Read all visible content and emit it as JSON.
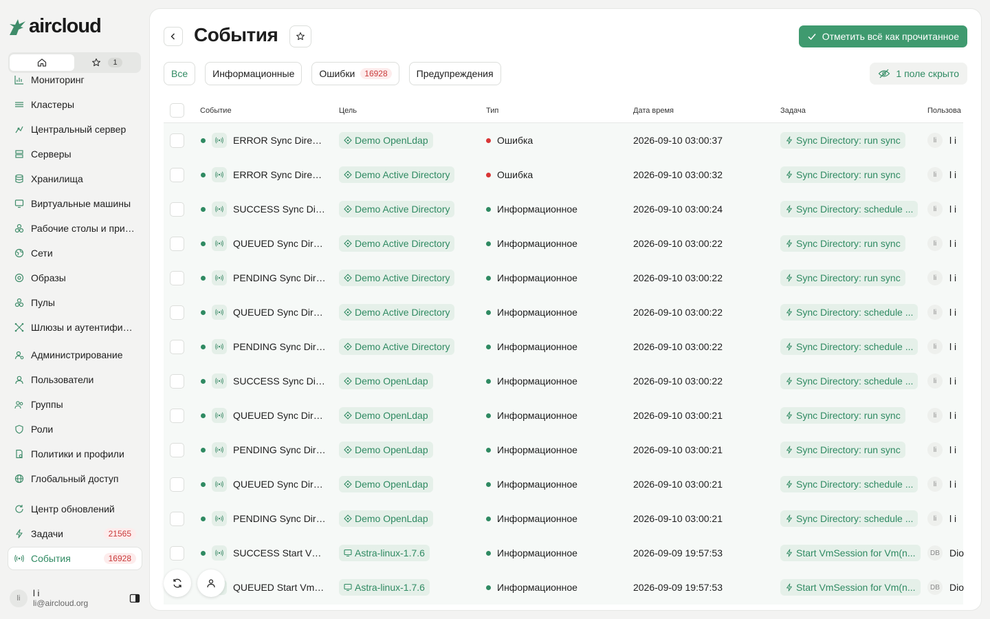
{
  "app": {
    "logo_text": "aircloud"
  },
  "quick": {
    "fav_count": "1"
  },
  "nav": [
    {
      "label": "Мониторинг",
      "icon": "chart-icon"
    },
    {
      "label": "Кластеры",
      "icon": "layers-icon"
    },
    {
      "label": "Центральный сервер",
      "icon": "sliders-icon"
    },
    {
      "label": "Серверы",
      "icon": "server-icon"
    },
    {
      "label": "Хранилища",
      "icon": "database-icon"
    },
    {
      "label": "Виртуальные машины",
      "icon": "monitor-icon"
    },
    {
      "label": "Рабочие столы и прил...",
      "icon": "desktop-apps-icon"
    },
    {
      "label": "Сети",
      "icon": "globe-network-icon"
    },
    {
      "label": "Образы",
      "icon": "disc-icon"
    },
    {
      "label": "Пулы",
      "icon": "pool-icon"
    },
    {
      "label": "Шлюзы и аутентифика...",
      "icon": "gateway-icon"
    },
    {
      "label": "Администрирование",
      "icon": "admin-icon"
    },
    {
      "label": "Пользователи",
      "icon": "user-icon"
    },
    {
      "label": "Группы",
      "icon": "group-icon"
    },
    {
      "label": "Роли",
      "icon": "shield-icon"
    },
    {
      "label": "Политики и профили",
      "icon": "policy-icon"
    },
    {
      "label": "Глобальный доступ",
      "icon": "globe-icon"
    },
    {
      "label": "Центр обновлений",
      "icon": "refresh-icon"
    },
    {
      "label": "Задачи",
      "icon": "bolt-icon",
      "count": "21565"
    },
    {
      "label": "События",
      "icon": "broadcast-icon",
      "count": "16928",
      "active": true
    }
  ],
  "user": {
    "initials": "li",
    "name": "l i",
    "email": "li@aircloud.org"
  },
  "page": {
    "title": "События",
    "mark_all_read": "Отметить всё как прочитанное",
    "hidden_fields": "1 поле скрыто"
  },
  "tabs": [
    {
      "label": "Все",
      "active": true
    },
    {
      "label": "Информационные"
    },
    {
      "label": "Ошибки",
      "count": "16928"
    },
    {
      "label": "Предупреждения"
    }
  ],
  "columns": [
    "Событие",
    "Цель",
    "Тип",
    "Дата время",
    "Задача",
    "Пользова"
  ],
  "rows": [
    {
      "event": "ERROR Sync Directory: run sync",
      "target": "Demo OpenLdap",
      "target_icon": "directory-icon",
      "type": "Ошибка",
      "type_color": "#d93636",
      "datetime": "2026-09-10 03:00:37",
      "task": "Sync Directory: run sync",
      "user_initials": "li",
      "user_name": "l i"
    },
    {
      "event": "ERROR Sync Directory: run sync",
      "target": "Demo Active Directory",
      "target_icon": "directory-icon",
      "type": "Ошибка",
      "type_color": "#d93636",
      "datetime": "2026-09-10 03:00:32",
      "task": "Sync Directory: run sync",
      "user_initials": "li",
      "user_name": "l i"
    },
    {
      "event": "SUCCESS Sync Directory: schedule",
      "target": "Demo Active Directory",
      "target_icon": "directory-icon",
      "type": "Информационное",
      "type_color": "#2f8a62",
      "datetime": "2026-09-10 03:00:24",
      "task": "Sync Directory: schedule ...",
      "user_initials": "li",
      "user_name": "l i"
    },
    {
      "event": "QUEUED Sync Directory: run sync",
      "target": "Demo Active Directory",
      "target_icon": "directory-icon",
      "type": "Информационное",
      "type_color": "#2f8a62",
      "datetime": "2026-09-10 03:00:22",
      "task": "Sync Directory: run sync",
      "user_initials": "li",
      "user_name": "l i"
    },
    {
      "event": "PENDING Sync Directory: run sync",
      "target": "Demo Active Directory",
      "target_icon": "directory-icon",
      "type": "Информационное",
      "type_color": "#2f8a62",
      "datetime": "2026-09-10 03:00:22",
      "task": "Sync Directory: run sync",
      "user_initials": "li",
      "user_name": "l i"
    },
    {
      "event": "QUEUED Sync Directory: schedule",
      "target": "Demo Active Directory",
      "target_icon": "directory-icon",
      "type": "Информационное",
      "type_color": "#2f8a62",
      "datetime": "2026-09-10 03:00:22",
      "task": "Sync Directory: schedule ...",
      "user_initials": "li",
      "user_name": "l i"
    },
    {
      "event": "PENDING Sync Directory: schedule",
      "target": "Demo Active Directory",
      "target_icon": "directory-icon",
      "type": "Информационное",
      "type_color": "#2f8a62",
      "datetime": "2026-09-10 03:00:22",
      "task": "Sync Directory: schedule ...",
      "user_initials": "li",
      "user_name": "l i"
    },
    {
      "event": "SUCCESS Sync Directory: schedule",
      "target": "Demo OpenLdap",
      "target_icon": "directory-icon",
      "type": "Информационное",
      "type_color": "#2f8a62",
      "datetime": "2026-09-10 03:00:22",
      "task": "Sync Directory: schedule ...",
      "user_initials": "li",
      "user_name": "l i"
    },
    {
      "event": "QUEUED Sync Directory: run sync",
      "target": "Demo OpenLdap",
      "target_icon": "directory-icon",
      "type": "Информационное",
      "type_color": "#2f8a62",
      "datetime": "2026-09-10 03:00:21",
      "task": "Sync Directory: run sync",
      "user_initials": "li",
      "user_name": "l i"
    },
    {
      "event": "PENDING Sync Directory: run sync",
      "target": "Demo OpenLdap",
      "target_icon": "directory-icon",
      "type": "Информационное",
      "type_color": "#2f8a62",
      "datetime": "2026-09-10 03:00:21",
      "task": "Sync Directory: run sync",
      "user_initials": "li",
      "user_name": "l i"
    },
    {
      "event": "QUEUED Sync Directory: schedule",
      "target": "Demo OpenLdap",
      "target_icon": "directory-icon",
      "type": "Информационное",
      "type_color": "#2f8a62",
      "datetime": "2026-09-10 03:00:21",
      "task": "Sync Directory: schedule ...",
      "user_initials": "li",
      "user_name": "l i"
    },
    {
      "event": "PENDING Sync Directory: schedule",
      "target": "Demo OpenLdap",
      "target_icon": "directory-icon",
      "type": "Информационное",
      "type_color": "#2f8a62",
      "datetime": "2026-09-10 03:00:21",
      "task": "Sync Directory: schedule ...",
      "user_initials": "li",
      "user_name": "l i"
    },
    {
      "event": "SUCCESS Start VmSession",
      "target": "Astra-linux-1.7.6",
      "target_icon": "vm-icon",
      "type": "Информационное",
      "type_color": "#2f8a62",
      "datetime": "2026-09-09 19:57:53",
      "task": "Start VmSession for Vm(n...",
      "user_initials": "DB",
      "user_name": "Dio"
    },
    {
      "event": "QUEUED Start VmSession",
      "target": "Astra-linux-1.7.6",
      "target_icon": "vm-icon",
      "type": "Информационное",
      "type_color": "#2f8a62",
      "datetime": "2026-09-09 19:57:53",
      "task": "Start VmSession for Vm(n...",
      "user_initials": "DB",
      "user_name": "Dio"
    }
  ],
  "colors": {
    "accent": "#3f9a6f",
    "error": "#d93636",
    "badge_bg": "#fdecec"
  }
}
